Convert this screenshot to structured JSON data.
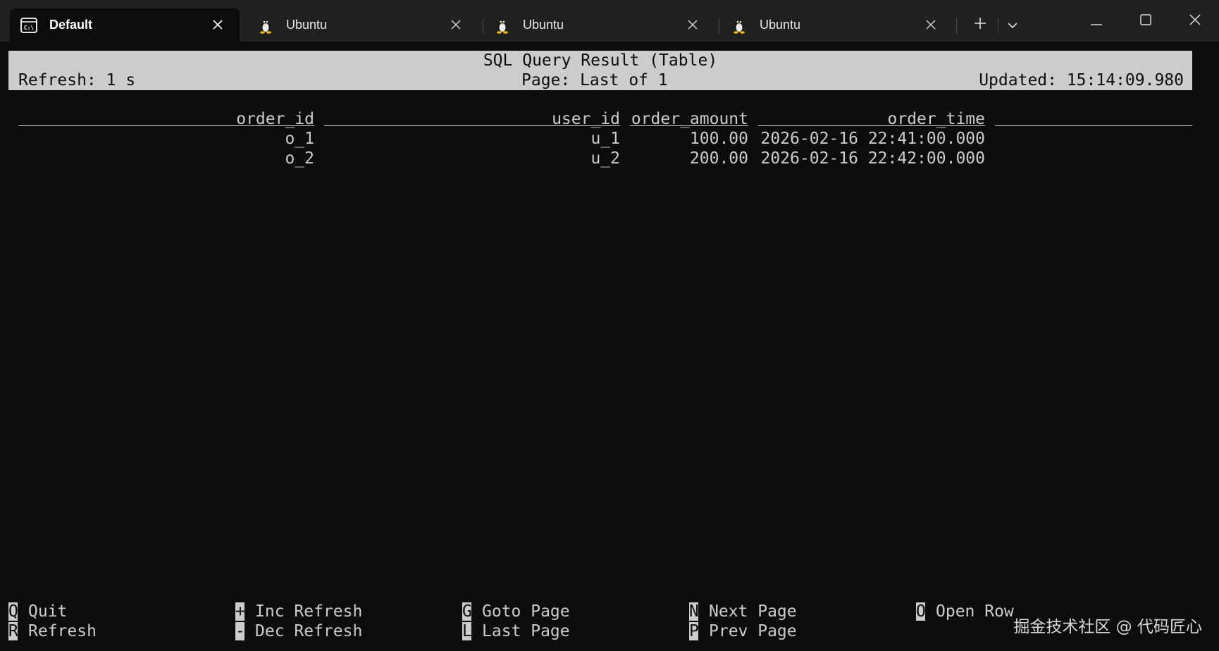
{
  "tabs": [
    {
      "label": "Default",
      "icon": "terminal-icon",
      "active": true
    },
    {
      "label": "Ubuntu",
      "icon": "linux-tux-icon",
      "active": false
    },
    {
      "label": "Ubuntu",
      "icon": "linux-tux-icon",
      "active": false
    },
    {
      "label": "Ubuntu",
      "icon": "linux-tux-icon",
      "active": false
    }
  ],
  "titlebar": {
    "new_tab_icon": "plus-icon",
    "dropdown_icon": "chevron-down-icon",
    "minimize_icon": "minimize-icon",
    "maximize_icon": "maximize-icon",
    "close_icon": "close-icon"
  },
  "header": {
    "title": "SQL Query Result (Table)",
    "refresh": "Refresh: 1 s",
    "page": "Page: Last of 1",
    "updated": "Updated: 15:14:09.980"
  },
  "table": {
    "columns": [
      "order_id",
      "user_id",
      "order_amount",
      "order_time"
    ],
    "rows": [
      [
        "o_1",
        "u_1",
        "100.00",
        "2026-02-16 22:41:00.000"
      ],
      [
        "o_2",
        "u_2",
        "200.00",
        "2026-02-16 22:42:00.000"
      ]
    ]
  },
  "footer": {
    "shortcuts": [
      {
        "key": "Q",
        "label": "Quit"
      },
      {
        "key": "R",
        "label": "Refresh"
      },
      {
        "key": "+",
        "label": "Inc Refresh"
      },
      {
        "key": "-",
        "label": "Dec Refresh"
      },
      {
        "key": "G",
        "label": "Goto Page"
      },
      {
        "key": "L",
        "label": "Last Page"
      },
      {
        "key": "N",
        "label": "Next Page"
      },
      {
        "key": "P",
        "label": "Prev Page"
      },
      {
        "key": "O",
        "label": "Open Row"
      }
    ]
  },
  "watermark": "掘金技术社区 @ 代码匠心",
  "colors": {
    "background": "#0c0c0c",
    "titlebar": "#202020",
    "foreground": "#cccccc"
  }
}
